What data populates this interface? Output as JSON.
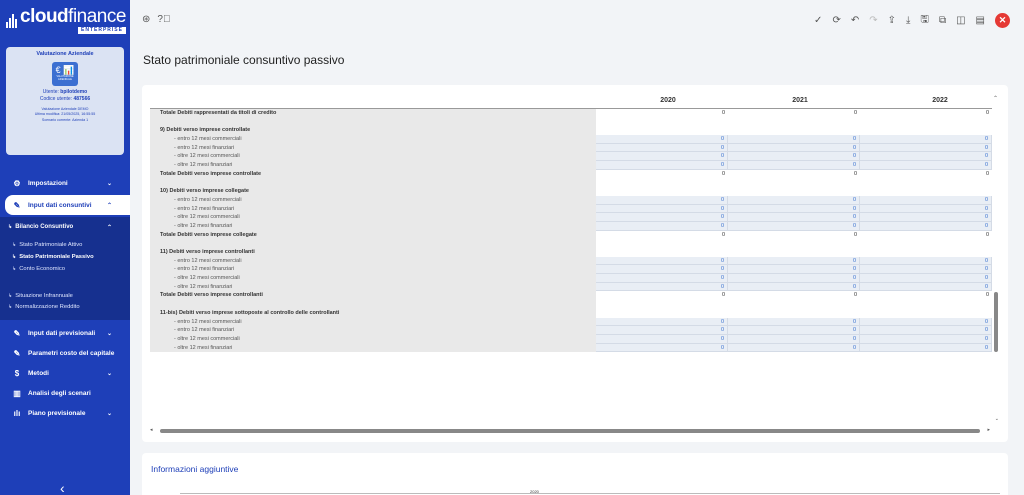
{
  "brand": {
    "name_bold": "cloud",
    "name_thin": "finance",
    "edition": "ENTERPRISE"
  },
  "profile": {
    "title": "Valutazione Aziendale",
    "icon_caption": "VALUTAZIONE AZIENDALE",
    "user_label": "Utente:",
    "user_value": "bpilotdemo",
    "code_label": "Codice utente:",
    "code_value": "487566",
    "demo_line": "Valutazione Aziendale DEMO",
    "modified_line": "Ultima modifica: 21/05/2025, 16:55:55",
    "scenario_line": "Scenario corrente: Azienda 1"
  },
  "nav": {
    "impostazioni": "Impostazioni",
    "input_consuntivi": "Input dati consuntivi",
    "bilancio_consuntivo": "Bilancio Consuntivo",
    "sub_items": [
      "Stato Patrimoniale Attivo",
      "Stato Patrimoniale Passivo",
      "Conto Economico"
    ],
    "situazione": "Situazione Infrannuale",
    "normalizzazione": "Normalizzazione Reddito",
    "input_previsionali": "Input dati previsionali",
    "parametri": "Parametri costo del capitale",
    "metodi": "Metodi",
    "analisi": "Analisi degli scenari",
    "piano": "Piano previsionale"
  },
  "page": {
    "title": "Stato patrimoniale consuntivo passivo"
  },
  "table": {
    "years": [
      "2020",
      "2021",
      "2022"
    ],
    "rows": [
      {
        "type": "total",
        "label": "Totale Debiti rappresentati da titoli di credito",
        "values": [
          "0",
          "0",
          "0"
        ]
      },
      {
        "type": "blank",
        "label": "",
        "values": [
          "",
          "",
          ""
        ]
      },
      {
        "type": "header",
        "label": "9) Debiti verso imprese controllate",
        "values": [
          "",
          "",
          ""
        ]
      },
      {
        "type": "data",
        "label": "- entro 12 mesi commerciali",
        "values": [
          "0",
          "0",
          "0"
        ]
      },
      {
        "type": "data",
        "label": "- entro 12 mesi finanziari",
        "values": [
          "0",
          "0",
          "0"
        ]
      },
      {
        "type": "data",
        "label": "- oltre 12 mesi commerciali",
        "values": [
          "0",
          "0",
          "0"
        ]
      },
      {
        "type": "data",
        "label": "- oltre 12 mesi finanziari",
        "values": [
          "0",
          "0",
          "0"
        ]
      },
      {
        "type": "total",
        "label": "Totale Debiti verso imprese controllate",
        "values": [
          "0",
          "0",
          "0"
        ]
      },
      {
        "type": "blank",
        "label": "",
        "values": [
          "",
          "",
          ""
        ]
      },
      {
        "type": "header",
        "label": "10) Debiti verso imprese collegate",
        "values": [
          "",
          "",
          ""
        ]
      },
      {
        "type": "data",
        "label": "- entro 12 mesi commerciali",
        "values": [
          "0",
          "0",
          "0"
        ]
      },
      {
        "type": "data",
        "label": "- entro 12 mesi finanziari",
        "values": [
          "0",
          "0",
          "0"
        ]
      },
      {
        "type": "data",
        "label": "- oltre 12 mesi commerciali",
        "values": [
          "0",
          "0",
          "0"
        ]
      },
      {
        "type": "data",
        "label": "- oltre 12 mesi finanziari",
        "values": [
          "0",
          "0",
          "0"
        ]
      },
      {
        "type": "total",
        "label": "Totale Debiti verso imprese collegate",
        "values": [
          "0",
          "0",
          "0"
        ]
      },
      {
        "type": "blank",
        "label": "",
        "values": [
          "",
          "",
          ""
        ]
      },
      {
        "type": "header",
        "label": "11) Debiti verso imprese controllanti",
        "values": [
          "",
          "",
          ""
        ]
      },
      {
        "type": "data",
        "label": "- entro 12 mesi commerciali",
        "values": [
          "0",
          "0",
          "0"
        ]
      },
      {
        "type": "data",
        "label": "- entro 12 mesi finanziari",
        "values": [
          "0",
          "0",
          "0"
        ]
      },
      {
        "type": "data",
        "label": "- oltre 12 mesi commerciali",
        "values": [
          "0",
          "0",
          "0"
        ]
      },
      {
        "type": "data",
        "label": "- oltre 12 mesi finanziari",
        "values": [
          "0",
          "0",
          "0"
        ]
      },
      {
        "type": "total",
        "label": "Totale Debiti verso imprese controllanti",
        "values": [
          "0",
          "0",
          "0"
        ]
      },
      {
        "type": "blank",
        "label": "",
        "values": [
          "",
          "",
          ""
        ]
      },
      {
        "type": "header",
        "label": "11-bis) Debiti verso imprese sottoposte al controllo delle controllanti",
        "values": [
          "",
          "",
          ""
        ]
      },
      {
        "type": "data",
        "label": "- entro 12 mesi commerciali",
        "values": [
          "0",
          "0",
          "0"
        ]
      },
      {
        "type": "data",
        "label": "- entro 12 mesi finanziari",
        "values": [
          "0",
          "0",
          "0"
        ]
      },
      {
        "type": "data",
        "label": "- oltre 12 mesi commerciali",
        "values": [
          "0",
          "0",
          "0"
        ]
      },
      {
        "type": "data",
        "label": "- oltre 12 mesi finanziari",
        "values": [
          "0",
          "0",
          "0"
        ]
      }
    ]
  },
  "info": {
    "title": "Informazioni aggiuntive",
    "year": "2020"
  }
}
